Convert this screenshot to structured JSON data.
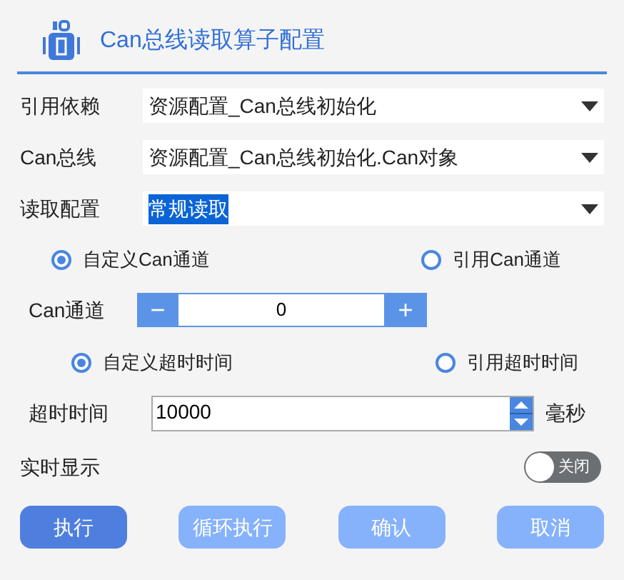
{
  "header": {
    "title": "Can总线读取算子配置"
  },
  "fields": [
    {
      "label": "引用依赖",
      "value": "资源配置_Can总线初始化",
      "text_selected": false
    },
    {
      "label": "Can总线",
      "value": "资源配置_Can总线初始化.Can对象",
      "text_selected": false
    },
    {
      "label": "读取配置",
      "value": "常规读取",
      "text_selected": true
    }
  ],
  "channel_mode": [
    {
      "label": "自定义Can通道",
      "selected": true
    },
    {
      "label": "引用Can通道",
      "selected": false
    }
  ],
  "channel": {
    "label": "Can通道",
    "minus": "−",
    "value": "0",
    "plus": "+"
  },
  "timeout_mode": [
    {
      "label": "自定义超时时间",
      "selected": true
    },
    {
      "label": "引用超时时间",
      "selected": false
    }
  ],
  "timeout": {
    "label": "超时时间",
    "value": "10000",
    "unit": "毫秒"
  },
  "realtime": {
    "label": "实时显示",
    "on": false,
    "state_text": "关闭"
  },
  "buttons": [
    {
      "label": "执行",
      "disabled": false
    },
    {
      "label": "循环执行",
      "disabled": true
    },
    {
      "label": "确认",
      "disabled": true
    },
    {
      "label": "取消",
      "disabled": true
    }
  ]
}
